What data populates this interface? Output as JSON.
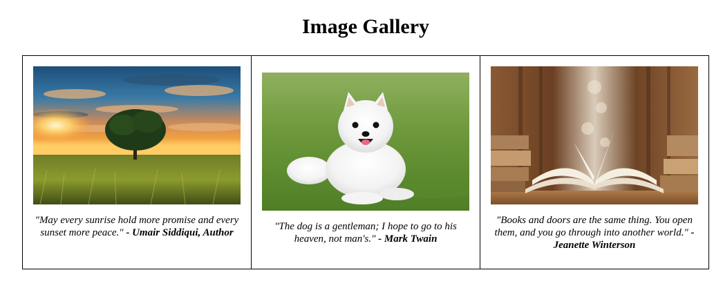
{
  "page": {
    "title": "Image Gallery"
  },
  "gallery": {
    "items": [
      {
        "image": "sunset-lone-tree-field",
        "quote": "\"May every sunrise hold more promise and every sunset more peace.\"",
        "author": "- Umair Siddiqui, Author"
      },
      {
        "image": "white-pomeranian-on-grass",
        "quote": "\"The dog is a gentleman; I hope to go to his heaven, not man's.\"",
        "author": "- Mark Twain"
      },
      {
        "image": "open-book-in-library",
        "quote": "\"Books and doors are the same thing. You open them, and you go through into another world.\"",
        "author": "- Jeanette Winterson"
      }
    ]
  }
}
